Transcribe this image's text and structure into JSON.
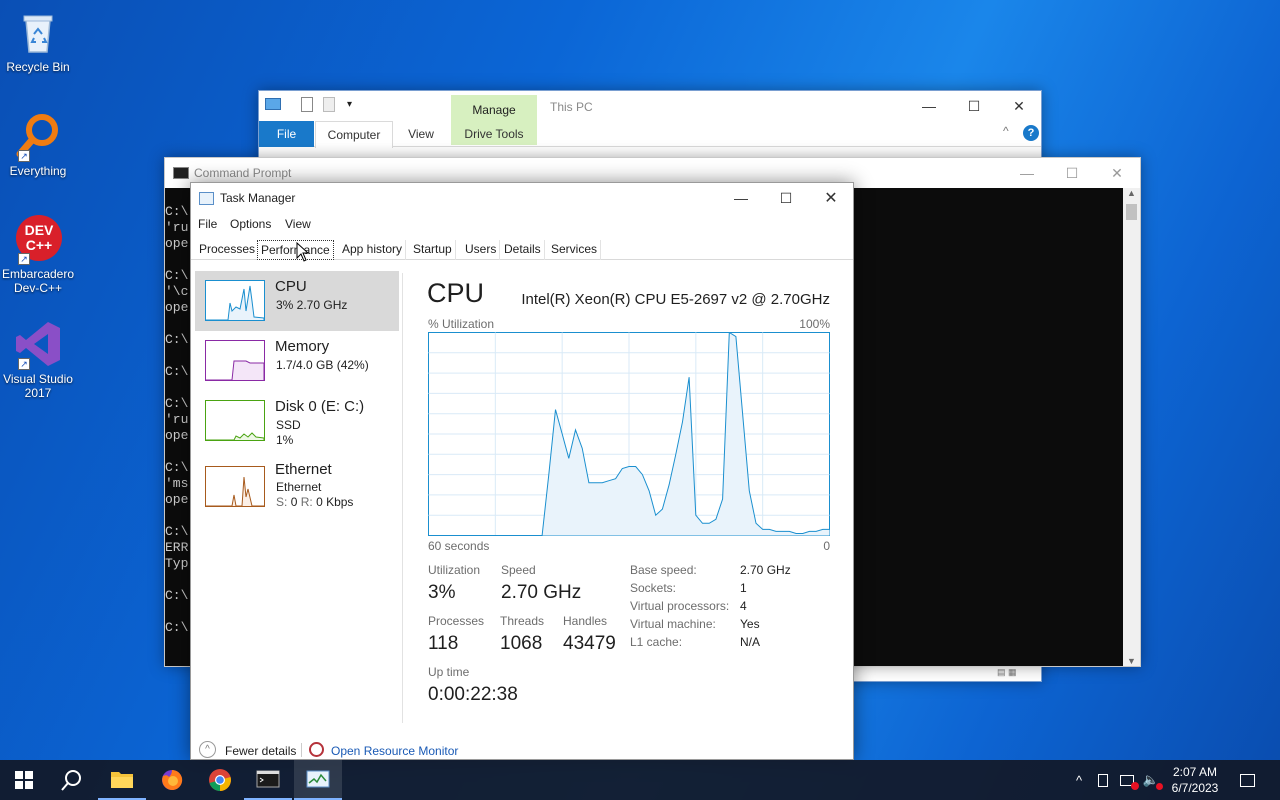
{
  "desktop": {
    "icons": [
      {
        "label": "Recycle Bin"
      },
      {
        "label": "Everything"
      },
      {
        "label_line1": "Embarcadero",
        "label_line2": "Dev-C++",
        "logo_line1": "DEV",
        "logo_line2": "C++"
      },
      {
        "label_line1": "Visual Studio",
        "label_line2": "2017"
      }
    ]
  },
  "explorer": {
    "title": "This PC",
    "context_tab": "Manage",
    "tabs": [
      "File",
      "Computer",
      "View"
    ],
    "drive_tools": "Drive Tools"
  },
  "cmd": {
    "title": "Command Prompt",
    "lines": [
      "C:\\",
      "'ru",
      "ope",
      "",
      "C:\\",
      "'\\c",
      "ope",
      "",
      "C:\\",
      "",
      "C:\\",
      "",
      "C:\\",
      "'ru",
      "ope",
      "",
      "C:\\",
      "'ms",
      "ope",
      "",
      "C:\\",
      "ERR",
      "Typ",
      "",
      "C:\\",
      "",
      "C:\\"
    ]
  },
  "taskmgr": {
    "title": "Task Manager",
    "menu": [
      "File",
      "Options",
      "View"
    ],
    "tabs": [
      "Processes",
      "Performance",
      "App history",
      "Startup",
      "Users",
      "Details",
      "Services"
    ],
    "active_tab": "Performance",
    "sidebar": {
      "cpu": {
        "name": "CPU",
        "stat": "3% 2.70 GHz"
      },
      "memory": {
        "name": "Memory",
        "stat": "1.7/4.0 GB (42%)"
      },
      "disk": {
        "name": "Disk 0 (E: C:)",
        "stat1": "SSD",
        "stat2": "1%"
      },
      "ethernet": {
        "name": "Ethernet",
        "stat1": "Ethernet",
        "stat2_label": "S:",
        "stat2_s": "0",
        "stat2_r_label": "R:",
        "stat2_r": "0 Kbps"
      }
    },
    "detail": {
      "heading": "CPU",
      "model": "Intel(R) Xeon(R) CPU E5-2697 v2 @ 2.70GHz",
      "graph_label": "% Utilization",
      "graph_max": "100%",
      "graph_time": "60 seconds",
      "graph_min": "0",
      "utilization_label": "Utilization",
      "utilization": "3%",
      "speed_label": "Speed",
      "speed": "2.70 GHz",
      "processes_label": "Processes",
      "processes": "118",
      "threads_label": "Threads",
      "threads": "1068",
      "handles_label": "Handles",
      "handles": "43479",
      "uptime_label": "Up time",
      "uptime": "0:00:22:38",
      "specs": [
        {
          "k": "Base speed:",
          "v": "2.70 GHz"
        },
        {
          "k": "Sockets:",
          "v": "1"
        },
        {
          "k": "Virtual processors:",
          "v": "4"
        },
        {
          "k": "Virtual machine:",
          "v": "Yes"
        },
        {
          "k": "L1 cache:",
          "v": "N/A"
        }
      ]
    },
    "footer": {
      "fewer": "Fewer details",
      "resmon": "Open Resource Monitor"
    }
  },
  "chart_data": {
    "type": "area",
    "ylim": [
      0,
      100
    ],
    "x": [
      60,
      57,
      54,
      51,
      50,
      49,
      48,
      47,
      46,
      45,
      44,
      43,
      42,
      41,
      40,
      39,
      38,
      37,
      36,
      35,
      34,
      33,
      32,
      31,
      30,
      29,
      28,
      27,
      26,
      25,
      24,
      23,
      22,
      21,
      20,
      19,
      18,
      17,
      16,
      15,
      14,
      13,
      12,
      11,
      10,
      9,
      8,
      7,
      6,
      5,
      4,
      3,
      2,
      1,
      0
    ],
    "values": [
      0,
      0,
      0,
      0,
      0,
      0,
      0,
      0,
      0,
      0,
      0,
      0,
      30,
      62,
      50,
      38,
      52,
      43,
      26,
      26,
      26,
      27,
      28,
      33,
      34,
      34,
      30,
      22,
      10,
      13,
      25,
      40,
      56,
      78,
      10,
      6,
      6,
      8,
      18,
      100,
      98,
      60,
      22,
      6,
      3,
      3,
      2,
      2,
      2,
      1,
      1,
      2,
      2,
      3,
      3
    ]
  },
  "taskbar": {
    "time": "2:07 AM",
    "date": "6/7/2023"
  },
  "colors": {
    "cpu_line": "#1a8fcf",
    "cpu_fill": "#e9f3fb",
    "memory": "#8a2aa5",
    "disk": "#4aa312",
    "ethernet": "#a75a1d",
    "link": "#1a5ab5"
  }
}
